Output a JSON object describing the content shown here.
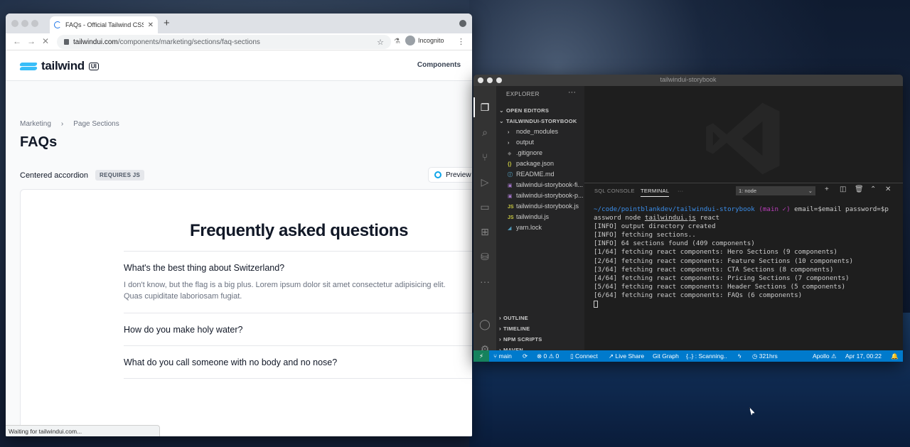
{
  "browser": {
    "tab_title": "FAQs - Official Tailwind CSS UI",
    "new_tab": "+",
    "url_host": "tailwindui.com",
    "url_path": "/components/marketing/sections/faq-sections",
    "incognito_label": "Incognito",
    "status_text": "Waiting for tailwindui.com..."
  },
  "site": {
    "logo_text": "tailwind",
    "logo_badge": "UI",
    "nav_components": "Components",
    "breadcrumb": [
      "Marketing",
      "Page Sections"
    ],
    "page_title": "FAQs",
    "section_name": "Centered accordion",
    "requires_badge": "REQUIRES JS",
    "preview_label": "Preview",
    "faq_heading": "Frequently asked questions",
    "faqs": [
      {
        "question": "What's the best thing about Switzerland?",
        "answer": "I don't know, but the flag is a big plus. Lorem ipsum dolor sit amet consectetur adipisicing elit. Quas cupiditate laboriosam fugiat."
      },
      {
        "question": "How do you make holy water?",
        "answer": ""
      },
      {
        "question": "What do you call someone with no body and no nose?",
        "answer": ""
      }
    ]
  },
  "vscode": {
    "window_title": "tailwindui-storybook",
    "explorer_title": "EXPLORER",
    "open_editors": "OPEN EDITORS",
    "project": "TAILWINDUI-STORYBOOK",
    "files": [
      {
        "name": "node_modules",
        "icon": ">",
        "kind": "folder"
      },
      {
        "name": "output",
        "icon": ">",
        "kind": "folder"
      },
      {
        "name": ".gitignore",
        "icon": "◆",
        "kind": "file",
        "color": "#6d6d6d"
      },
      {
        "name": "package.json",
        "icon": "{}",
        "kind": "file",
        "color": "#cbcb41"
      },
      {
        "name": "README.md",
        "icon": "i",
        "kind": "file",
        "color": "#519aba"
      },
      {
        "name": "tailwindui-storybook-fi...",
        "icon": "▣",
        "kind": "file",
        "color": "#a074c4"
      },
      {
        "name": "tailwindui-storybook-p...",
        "icon": "▣",
        "kind": "file",
        "color": "#a074c4"
      },
      {
        "name": "tailwindui-storybook.js",
        "icon": "JS",
        "kind": "file",
        "color": "#cbcb41"
      },
      {
        "name": "tailwindui.js",
        "icon": "JS",
        "kind": "file",
        "color": "#cbcb41"
      },
      {
        "name": "yarn.lock",
        "icon": "◢",
        "kind": "file",
        "color": "#519aba"
      }
    ],
    "bottom_sections": [
      "OUTLINE",
      "TIMELINE",
      "NPM SCRIPTS",
      "MAVEN"
    ],
    "panel_tabs": [
      "SQL CONSOLE",
      "TERMINAL"
    ],
    "panel_more": "···",
    "terminal_select": "1: node",
    "terminal": {
      "prompt_path": "~/code/pointblankdev/tailwindui-storybook",
      "prompt_branch": "(main ✓)",
      "command_1": " email=$email password=$p",
      "command_2_a": "assword node ",
      "command_2_file": "tailwindui.js",
      "command_2_b": " react",
      "lines": [
        "[INFO] output directory created",
        "[INFO] fetching sections..",
        "[INFO] 64 sections found (409 components)",
        "[1/64] fetching react components: Hero Sections (9 components)",
        "[2/64] fetching react components: Feature Sections (10 components)",
        "[3/64] fetching react components: CTA Sections (8 components)",
        "[4/64] fetching react components: Pricing Sections (7 components)",
        "[5/64] fetching react components: Header Sections (5 components)",
        "[6/64] fetching react components: FAQs (6 components)"
      ]
    },
    "status": {
      "branch": "main",
      "errors": "⊗ 0 ⚠ 0",
      "connect": "Connect",
      "live_share": "Live Share",
      "git_graph": "Git Graph",
      "scanning": "{..} : Scanning..",
      "hours": "321hrs",
      "apollo": "Apollo",
      "datetime": "Apr 17, 00:22"
    }
  },
  "colors": {
    "vscode_status": "#007acc",
    "tailwind_accent": "#38bdf8",
    "terminal_path": "#3b8eea"
  }
}
